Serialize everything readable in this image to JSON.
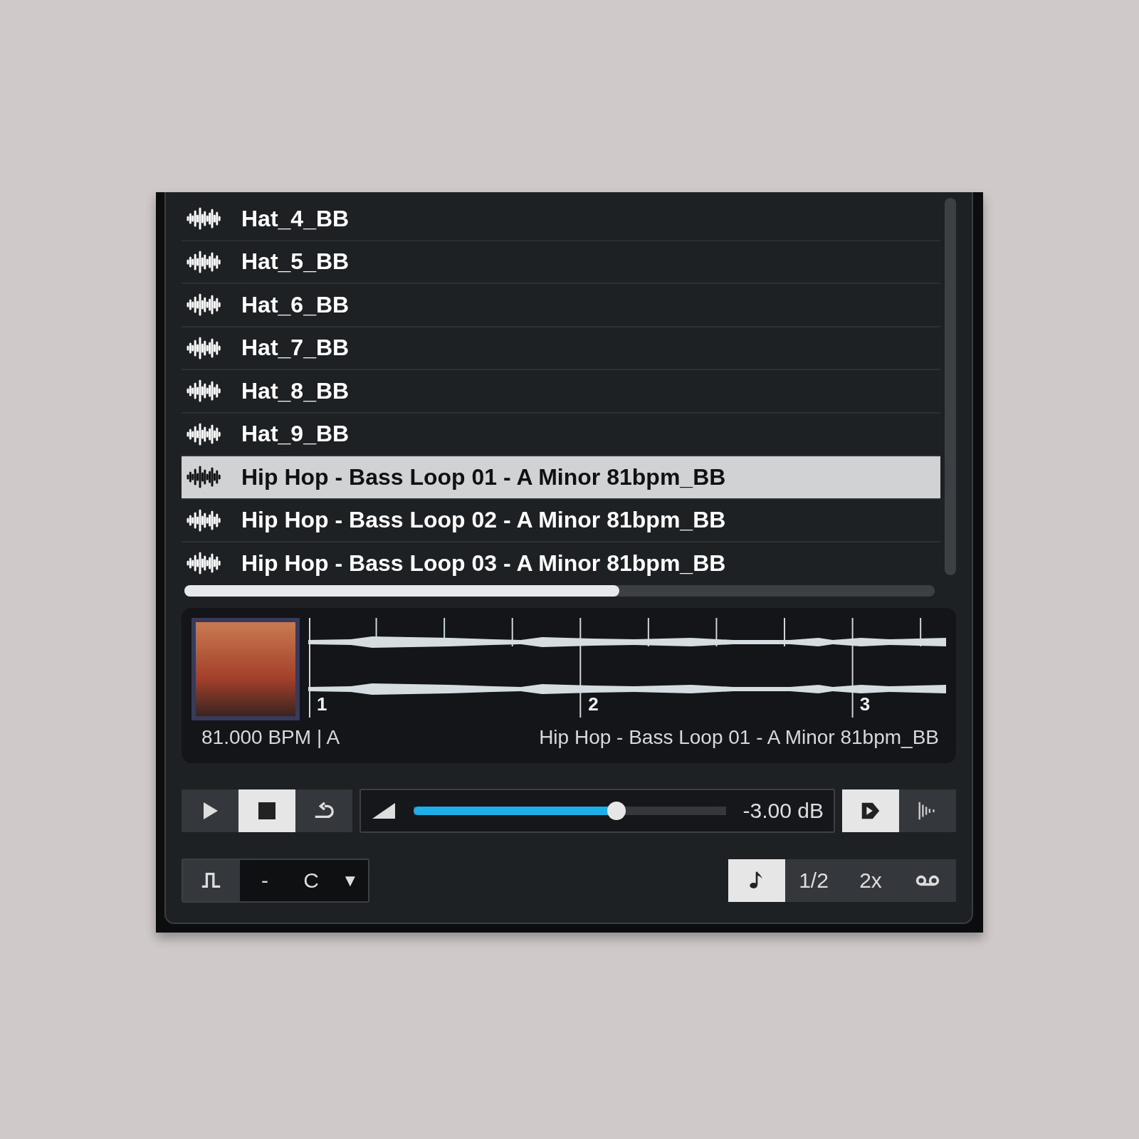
{
  "files": [
    {
      "name": "Hat_4_BB",
      "selected": false
    },
    {
      "name": "Hat_5_BB",
      "selected": false
    },
    {
      "name": "Hat_6_BB",
      "selected": false
    },
    {
      "name": "Hat_7_BB",
      "selected": false
    },
    {
      "name": "Hat_8_BB",
      "selected": false
    },
    {
      "name": "Hat_9_BB",
      "selected": false
    },
    {
      "name": "Hip Hop - Bass Loop 01 - A Minor 81bpm_BB",
      "selected": true
    },
    {
      "name": "Hip Hop - Bass Loop 02 - A Minor 81bpm_BB",
      "selected": false
    },
    {
      "name": "Hip Hop - Bass Loop 03 - A Minor 81bpm_BB",
      "selected": false
    }
  ],
  "preview": {
    "beat_labels": [
      "1",
      "2",
      "3"
    ],
    "tempo_key": "81.000 BPM | A",
    "file_name": "Hip Hop - Bass Loop 01 - A Minor 81bpm_BB"
  },
  "transport": [
    {
      "kind": "play",
      "selected": false
    },
    {
      "kind": "stop",
      "selected": true
    },
    {
      "kind": "loop",
      "selected": false
    }
  ],
  "volume": {
    "level": 0.65,
    "reading": "-3.00 dB"
  },
  "playback_options": [
    {
      "kind": "autoplay",
      "selected": true
    },
    {
      "kind": "sync",
      "selected": false
    }
  ],
  "pitch": {
    "value": "-",
    "key": "C",
    "caret": "▼"
  },
  "speed": [
    {
      "kind": "note",
      "selected": true
    },
    {
      "kind": "text",
      "label": "1/2",
      "selected": false
    },
    {
      "kind": "text",
      "label": "2x",
      "selected": false
    },
    {
      "kind": "tape",
      "selected": false
    }
  ]
}
